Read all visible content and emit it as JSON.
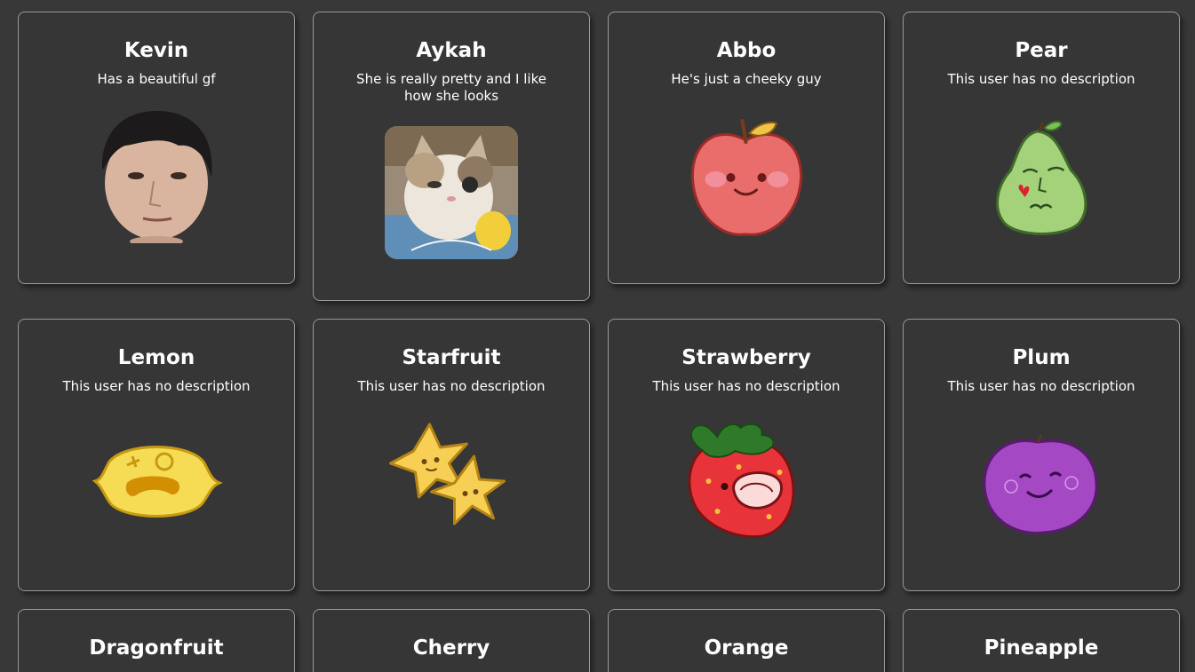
{
  "users": [
    {
      "name": "Kevin",
      "description": "Has a beautiful gf",
      "avatar": "boy-face-photo"
    },
    {
      "name": "Aykah",
      "description": "She is really pretty and I like how she looks",
      "avatar": "cat-photo"
    },
    {
      "name": "Abbo",
      "description": "He's just a cheeky guy",
      "avatar": "apple-icon"
    },
    {
      "name": "Pear",
      "description": "This user has no description",
      "avatar": "pear-icon"
    },
    {
      "name": "Lemon",
      "description": "This user has no description",
      "avatar": "lemon-icon"
    },
    {
      "name": "Starfruit",
      "description": "This user has no description",
      "avatar": "starfruit-icon"
    },
    {
      "name": "Strawberry",
      "description": "This user has no description",
      "avatar": "strawberry-icon"
    },
    {
      "name": "Plum",
      "description": "This user has no description",
      "avatar": "plum-icon"
    },
    {
      "name": "Dragonfruit",
      "description": "",
      "avatar": ""
    },
    {
      "name": "Cherry",
      "description": "",
      "avatar": ""
    },
    {
      "name": "Orange",
      "description": "",
      "avatar": ""
    },
    {
      "name": "Pineapple",
      "description": "",
      "avatar": ""
    }
  ],
  "colors": {
    "background": "#383838",
    "card": "#363636",
    "card_border": "#9a9a9a",
    "text": "#ffffff"
  }
}
